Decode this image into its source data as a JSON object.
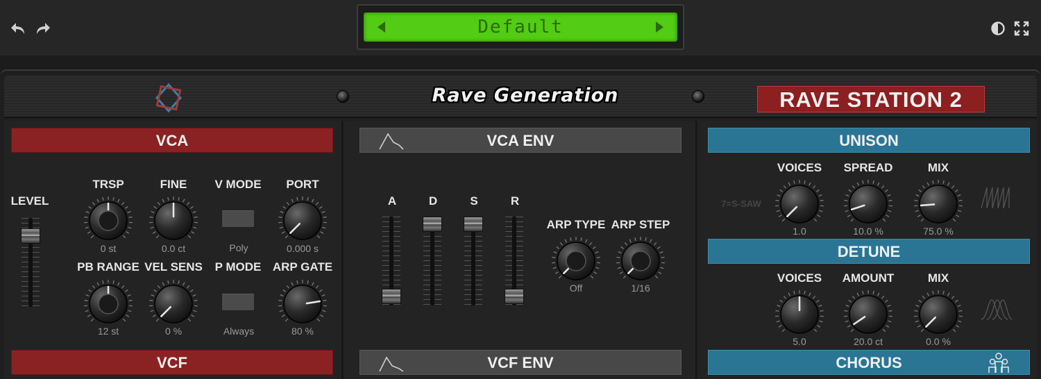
{
  "toolbar": {
    "undo_icon": "undo-arrow-icon",
    "redo_icon": "redo-arrow-icon",
    "preset_name": "Default",
    "contrast_icon": "contrast-icon",
    "fullscreen_icon": "fullscreen-icon"
  },
  "header": {
    "logo_icon": "star-logo-icon",
    "brand": "Rave Generation",
    "product": "RAVE STATION 2"
  },
  "vca": {
    "title": "VCA",
    "level": {
      "label": "LEVEL",
      "value": 0.86
    },
    "knobs": [
      {
        "key": "trsp",
        "label": "TRSP",
        "value": "0 st",
        "norm": 0.5
      },
      {
        "key": "fine",
        "label": "FINE",
        "value": "0.0 ct",
        "norm": 0.5
      },
      {
        "key": "port",
        "label": "PORT",
        "value": "0.000 s",
        "norm": 0.0
      },
      {
        "key": "pbrange",
        "label": "PB RANGE",
        "value": "12 st",
        "norm": 0.5
      },
      {
        "key": "velsens",
        "label": "VEL SENS",
        "value": "0 %",
        "norm": 0.0
      },
      {
        "key": "arpgate",
        "label": "ARP GATE",
        "value": "80 %",
        "norm": 0.8
      }
    ],
    "switches": [
      {
        "key": "vmode",
        "label": "V MODE",
        "value": "Poly"
      },
      {
        "key": "pmode",
        "label": "P MODE",
        "value": "Always"
      }
    ]
  },
  "vcf": {
    "title": "VCF"
  },
  "vca_env": {
    "title": "VCA ENV",
    "icon": "envelope-shape-icon",
    "faders": [
      {
        "label": "A",
        "value": 0.02
      },
      {
        "label": "D",
        "value": 1.0
      },
      {
        "label": "S",
        "value": 1.0
      },
      {
        "label": "R",
        "value": 0.02
      }
    ],
    "arp_type": {
      "label": "ARP TYPE",
      "value": "Off",
      "norm": 0.0
    },
    "arp_step": {
      "label": "ARP STEP",
      "value": "1/16",
      "norm": 0.0
    }
  },
  "vcf_env": {
    "title": "VCF ENV",
    "icon": "envelope-shape-icon"
  },
  "unison": {
    "title": "UNISON",
    "hint": "7=S-SAW",
    "icon": "supersaw-wave-icon",
    "knobs": [
      {
        "key": "voices",
        "label": "VOICES",
        "value": "1.0",
        "norm": 0.0
      },
      {
        "key": "spread",
        "label": "SPREAD",
        "value": "10.0 %",
        "norm": 0.1
      },
      {
        "key": "mix",
        "label": "MIX",
        "value": "75.0 %",
        "norm": 0.15
      }
    ]
  },
  "detune": {
    "title": "DETUNE",
    "icon": "detune-curves-icon",
    "knobs": [
      {
        "key": "voices",
        "label": "VOICES",
        "value": "5.0",
        "norm": 0.5
      },
      {
        "key": "amount",
        "label": "AMOUNT",
        "value": "20.0 ct",
        "norm": 0.04
      },
      {
        "key": "mix",
        "label": "MIX",
        "value": "0.0 %",
        "norm": 0.0
      }
    ]
  },
  "chorus": {
    "title": "CHORUS",
    "icon": "chorus-people-icon"
  }
}
